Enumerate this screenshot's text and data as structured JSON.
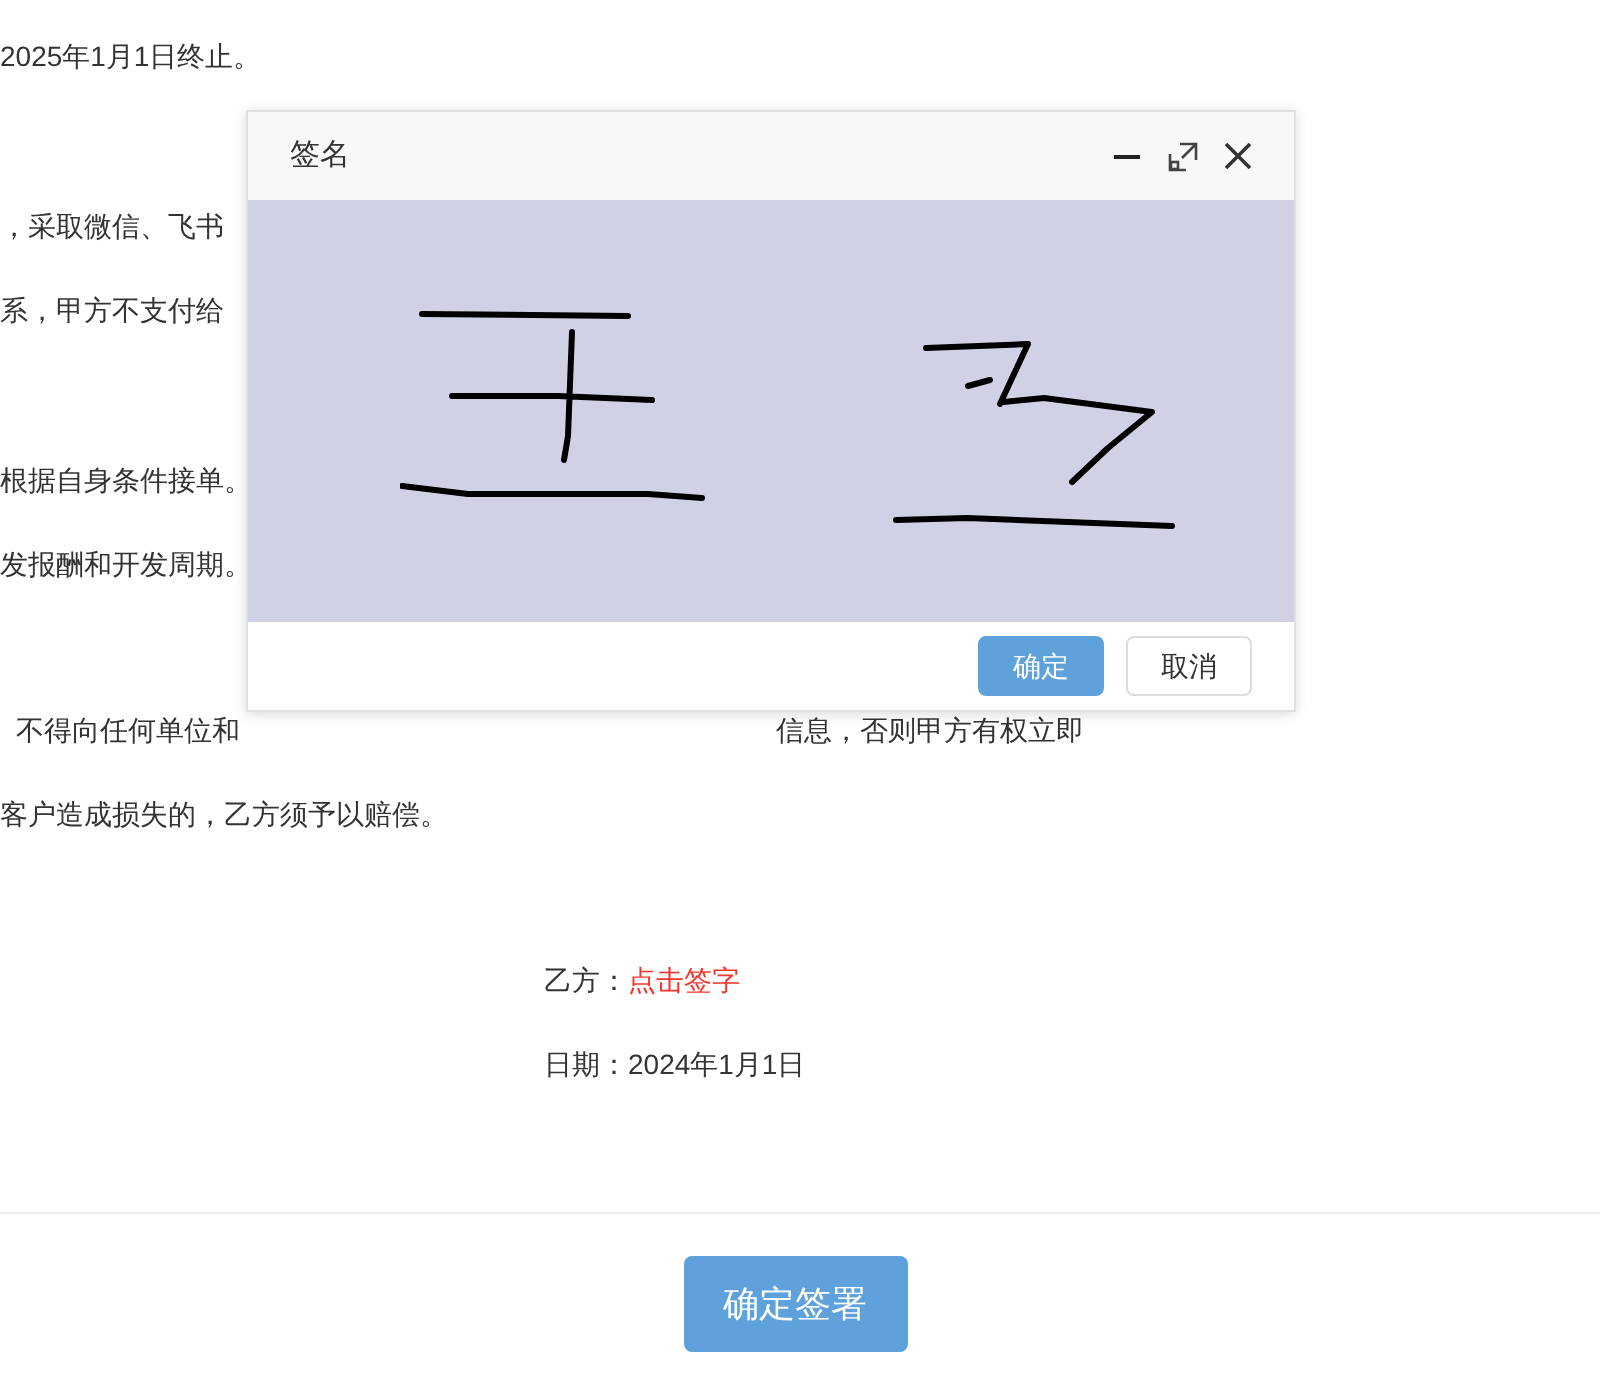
{
  "contract_lines": [
    {
      "parts": [
        "2025年1月1日终止。"
      ]
    },
    {
      "parts": [
        "，采取微信、飞书"
      ]
    },
    {
      "parts": [
        "系，甲方不支付给"
      ]
    },
    {
      "parts": [
        "根据自身条件接单。"
      ]
    },
    {
      "parts": [
        "发报酬和开发周期。"
      ]
    },
    {
      "parts": [
        "不得向任何单位和",
        "信息，否则甲方有权立即"
      ]
    },
    {
      "parts": [
        "客户造成损失的，乙方须予以赔偿。"
      ]
    }
  ],
  "signature": {
    "label": "乙方：",
    "action": "点击签字"
  },
  "date": "日期：2024年1月1日",
  "submit_button": "确定签署",
  "dialog": {
    "title": "签名",
    "buttons": [
      {
        "label": "确定",
        "kind": "primary"
      },
      {
        "label": "取消",
        "kind": "default"
      }
    ]
  }
}
